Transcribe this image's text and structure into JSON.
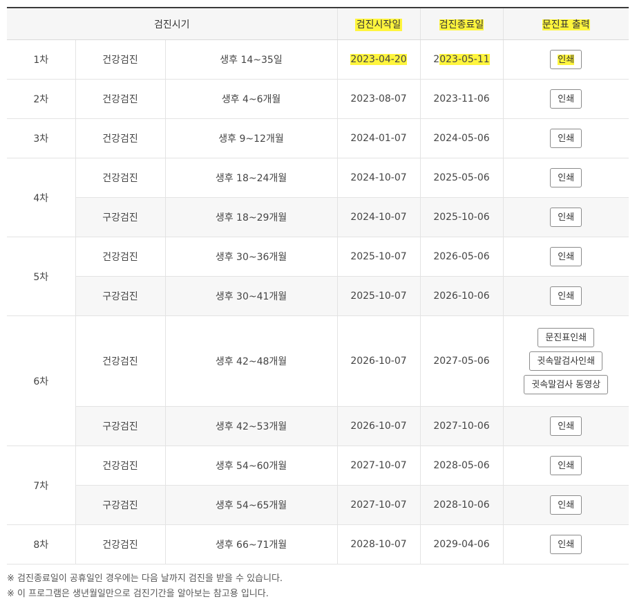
{
  "header": {
    "period": "검진시기",
    "start_date": "검진시작일",
    "end_date": "검진종료일",
    "print": "문진표 출력"
  },
  "rows": [
    {
      "round": "1차",
      "type": "건강검진",
      "age": "생후 14~35일",
      "start": "2023-04-20",
      "end_pre": "2",
      "end_hl": "023-05-11",
      "button": "인쇄"
    },
    {
      "round": "2차",
      "type": "건강검진",
      "age": "생후 4~6개월",
      "start": "2023-08-07",
      "end": "2023-11-06",
      "button": "인쇄"
    },
    {
      "round": "3차",
      "type": "건강검진",
      "age": "생후 9~12개월",
      "start": "2024-01-07",
      "end": "2024-05-06",
      "button": "인쇄"
    },
    {
      "round": "4차",
      "type": "건강검진",
      "age": "생후 18~24개월",
      "start": "2024-10-07",
      "end": "2025-05-06",
      "button": "인쇄"
    },
    {
      "type": "구강검진",
      "age": "생후 18~29개월",
      "start": "2024-10-07",
      "end": "2025-10-06",
      "button": "인쇄"
    },
    {
      "round": "5차",
      "type": "건강검진",
      "age": "생후 30~36개월",
      "start": "2025-10-07",
      "end": "2026-05-06",
      "button": "인쇄"
    },
    {
      "type": "구강검진",
      "age": "생후 30~41개월",
      "start": "2025-10-07",
      "end": "2026-10-06",
      "button": "인쇄"
    },
    {
      "round": "6차",
      "type": "건강검진",
      "age": "생후 42~48개월",
      "start": "2026-10-07",
      "end": "2027-05-06",
      "buttons": [
        "문진표인쇄",
        "귓속말검사인쇄",
        "귓속말검사 동영상"
      ]
    },
    {
      "type": "구강검진",
      "age": "생후 42~53개월",
      "start": "2026-10-07",
      "end": "2027-10-06",
      "button": "인쇄"
    },
    {
      "round": "7차",
      "type": "건강검진",
      "age": "생후 54~60개월",
      "start": "2027-10-07",
      "end": "2028-05-06",
      "button": "인쇄"
    },
    {
      "type": "구강검진",
      "age": "생후 54~65개월",
      "start": "2027-10-07",
      "end": "2028-10-06",
      "button": "인쇄"
    },
    {
      "round": "8차",
      "type": "건강검진",
      "age": "생후 66~71개월",
      "start": "2028-10-07",
      "end": "2029-04-06",
      "button": "인쇄"
    }
  ],
  "notes": [
    "※ 검진종료일이 공휴일인 경우에는 다음 날까지 검진을 받을 수 있습니다.",
    "※ 이 프로그램은 생년월일만으로 검진기간을 알아보는 참고용 입니다."
  ],
  "colors": {
    "highlight": "#fff53d",
    "alt_row": "#f7f7f7",
    "header_bg": "#f6f6f6"
  }
}
